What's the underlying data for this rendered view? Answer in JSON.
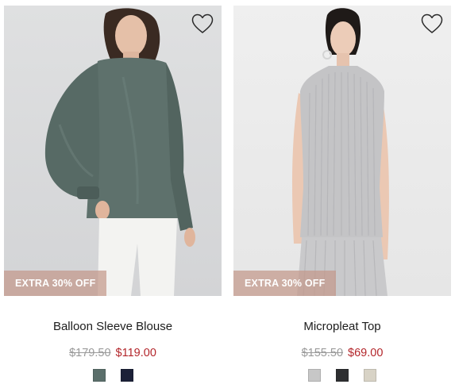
{
  "products": [
    {
      "name": "Balloon Sleeve Blouse",
      "promo_badge": "EXTRA 30% OFF",
      "original_price": "$179.50",
      "sale_price": "$119.00",
      "swatches": [
        "#5b6f6b",
        "#1c2138"
      ]
    },
    {
      "name": "Micropleat Top",
      "promo_badge": "EXTRA 30% OFF",
      "original_price": "$155.50",
      "sale_price": "$69.00",
      "swatches": [
        "#c7c7c7",
        "#2e2f31",
        "#d8d3c6"
      ]
    }
  ],
  "colors": {
    "sale_price": "#b3262b",
    "original_price": "#9a9a9a",
    "badge_background": "#c4988a"
  },
  "icons": {
    "wishlist": "heart-outline-icon"
  }
}
